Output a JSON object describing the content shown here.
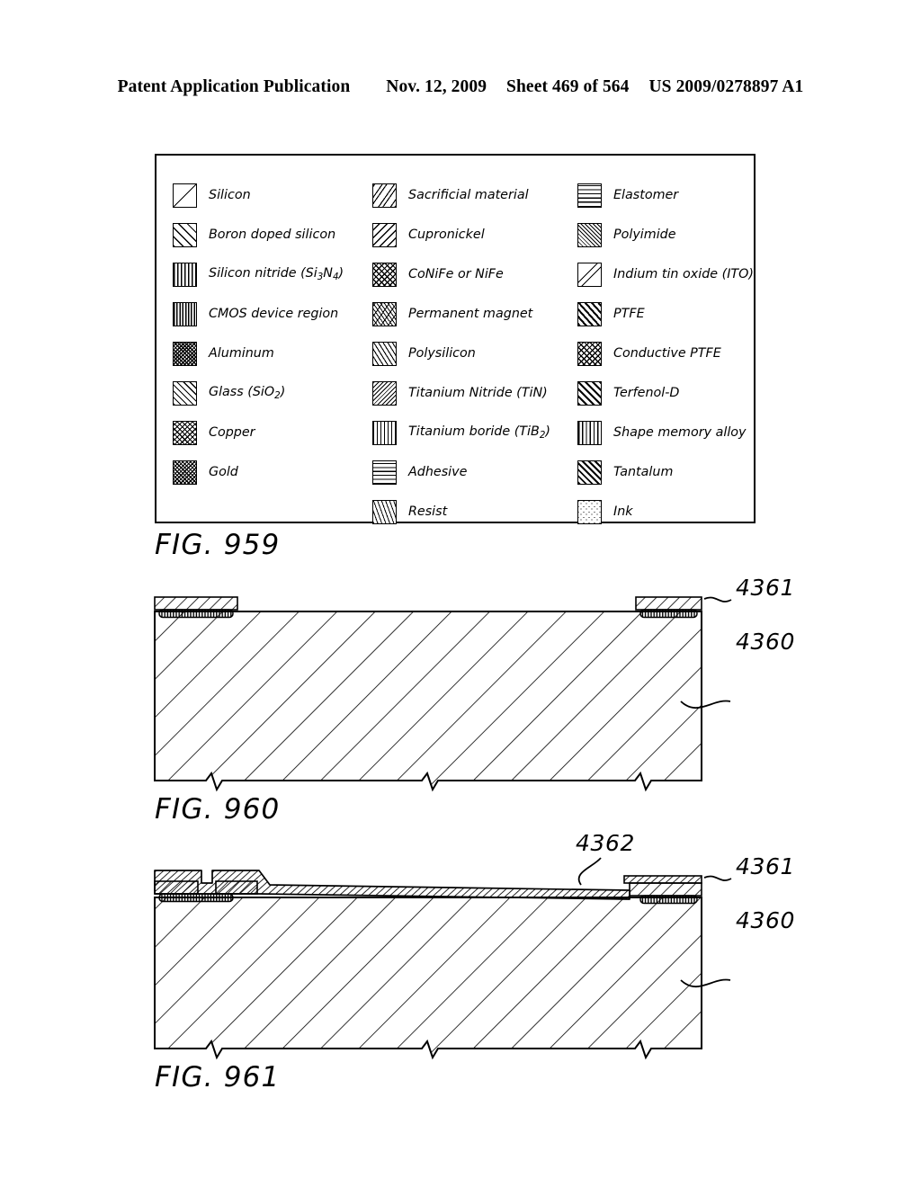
{
  "header": {
    "publication": "Patent Application Publication",
    "date": "Nov. 12, 2009",
    "sheet": "Sheet 469 of 564",
    "patent_number": "US 2009/0278897 A1"
  },
  "legend": {
    "columns": [
      {
        "items": [
          {
            "label": "Silicon",
            "pattern": "silicon"
          },
          {
            "label": "Boron doped silicon",
            "pattern": "diag-wide"
          },
          {
            "label": "Silicon nitride (Si3N4)",
            "label_html": "Silicon nitride (Si<sub>3</sub>N<sub>4</sub>)",
            "pattern": "vert"
          },
          {
            "label": "CMOS device region",
            "pattern": "vert-dense"
          },
          {
            "label": "Aluminum",
            "pattern": "dots-dark"
          },
          {
            "label": "Glass (SiO2)",
            "label_html": "Glass (SiO<sub>2</sub>)",
            "pattern": "diag-med"
          },
          {
            "label": "Copper",
            "pattern": "crosshatch"
          },
          {
            "label": "Gold",
            "pattern": "crosshatch-dense"
          }
        ]
      },
      {
        "items": [
          {
            "label": "Sacrificial material",
            "pattern": "sacrificial"
          },
          {
            "label": "Cupronickel",
            "pattern": "diag-back"
          },
          {
            "label": "CoNiFe or NiFe",
            "pattern": "cpvc"
          },
          {
            "label": "Permanent magnet",
            "pattern": "permag"
          },
          {
            "label": "Polysilicon",
            "pattern": "poly"
          },
          {
            "label": "Titanium Nitride (TiN)",
            "pattern": "diag-back-fine"
          },
          {
            "label": "Titanium boride (TiB2)",
            "label_html": "Titanium boride (TiB<sub>2</sub>)",
            "pattern": "tib2"
          },
          {
            "label": "Adhesive",
            "pattern": "horiz-dash"
          },
          {
            "label": "Resist",
            "pattern": "resist"
          }
        ]
      },
      {
        "items": [
          {
            "label": "Elastomer",
            "pattern": "elastomer"
          },
          {
            "label": "Polyimide",
            "pattern": "diag-fine"
          },
          {
            "label": "Indium tin oxide (ITO)",
            "pattern": "ito"
          },
          {
            "label": "PTFE",
            "pattern": "ptfe"
          },
          {
            "label": "Conductive PTFE",
            "pattern": "cpvc"
          },
          {
            "label": "Terfenol-D",
            "pattern": "terfenol"
          },
          {
            "label": "Shape memory alloy",
            "pattern": "sma"
          },
          {
            "label": "Tantalum",
            "pattern": "tantalum"
          },
          {
            "label": "Ink",
            "pattern": "ink"
          }
        ]
      }
    ]
  },
  "figures": [
    {
      "caption": "FIG. 959",
      "kind": "legend-key"
    },
    {
      "caption": "FIG. 960",
      "kind": "cross-section",
      "reference_numerals": [
        {
          "value": "4361",
          "target": "top-capping-layer"
        },
        {
          "value": "4360",
          "target": "substrate"
        }
      ]
    },
    {
      "caption": "FIG. 961",
      "kind": "cross-section",
      "reference_numerals": [
        {
          "value": "4362",
          "target": "conformal-deposited-layer"
        },
        {
          "value": "4361",
          "target": "top-capping-layer"
        },
        {
          "value": "4360",
          "target": "substrate"
        }
      ]
    }
  ]
}
